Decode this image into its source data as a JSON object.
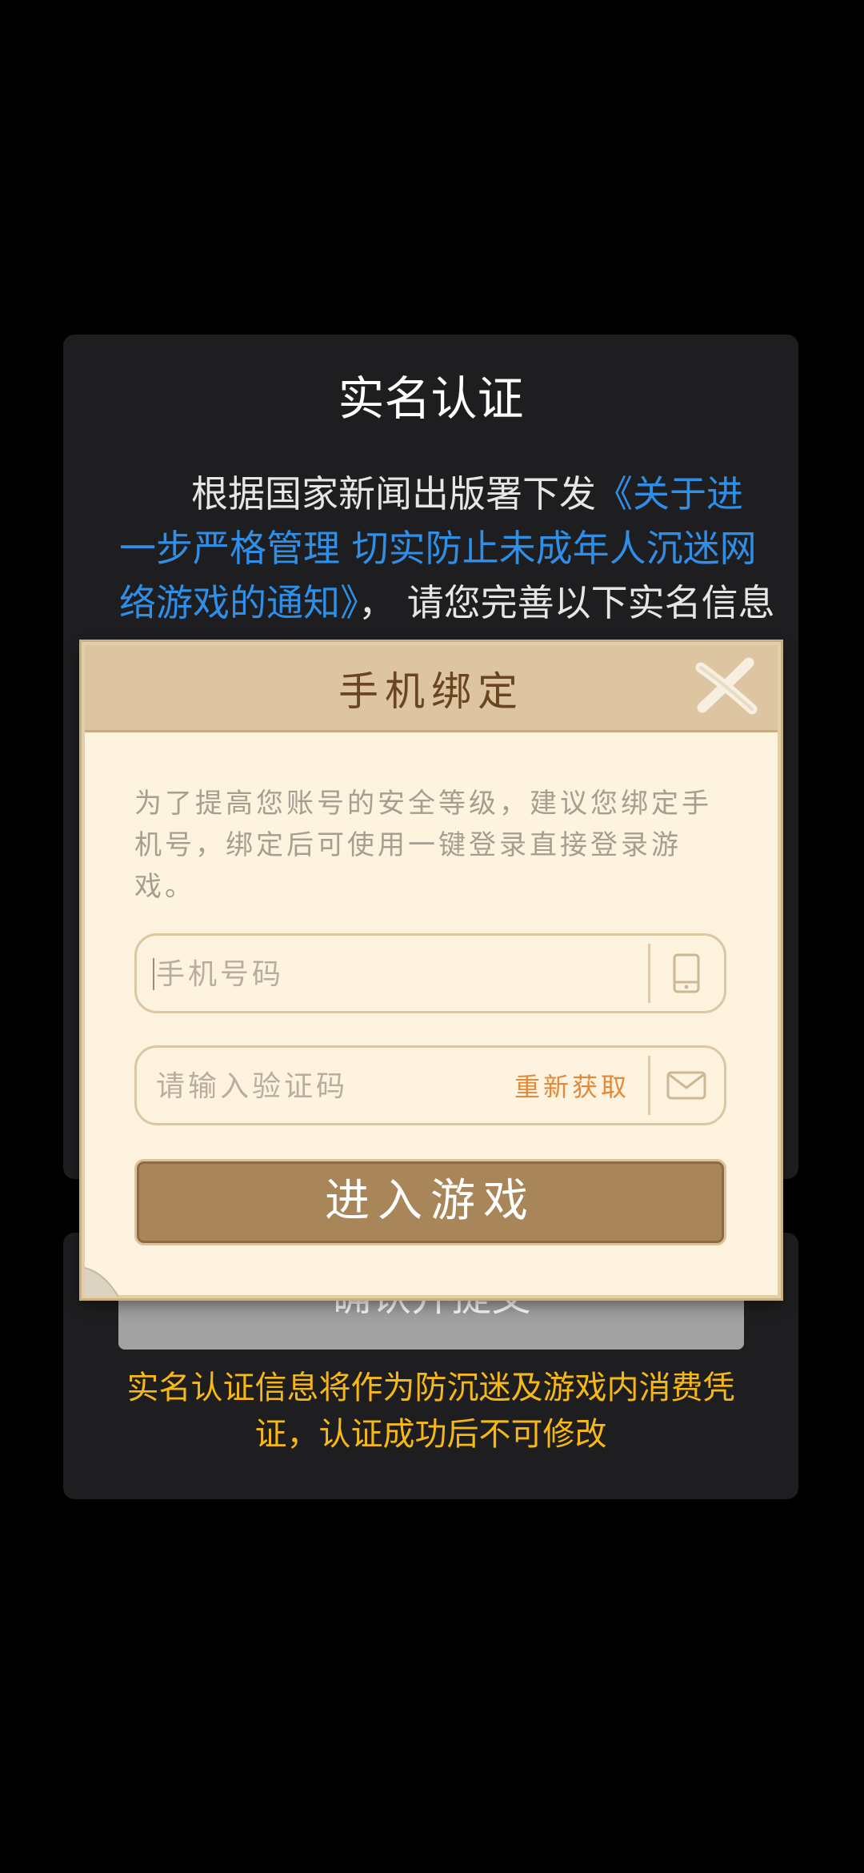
{
  "realname": {
    "title": "实名认证",
    "body_prefix": "根据国家新闻出版署下发",
    "body_link": "《关于进一步严格管理 切实防止未成年人沉迷网络游戏的通知》",
    "body_suffix": "， 请您完善以下实名信息",
    "submit_label": "确认并提交",
    "notice": "实名认证信息将作为防沉迷及游戏内消费凭证，认证成功后不可修改"
  },
  "phone_bind": {
    "title": "手机绑定",
    "description": "为了提高您账号的安全等级，建议您绑定手机号，绑定后可使用一键登录直接登录游戏。",
    "phone_placeholder": "手机号码",
    "code_placeholder": "请输入验证码",
    "resend_label": "重新获取",
    "enter_label": "进入游戏"
  },
  "colors": {
    "link": "#2f8ee6",
    "notice": "#f6b817",
    "parchment": "#fdf3df",
    "button_brown": "#a9865a",
    "resend_orange": "#e2893a"
  },
  "icons": [
    "close-icon",
    "phone-icon",
    "mail-icon"
  ]
}
